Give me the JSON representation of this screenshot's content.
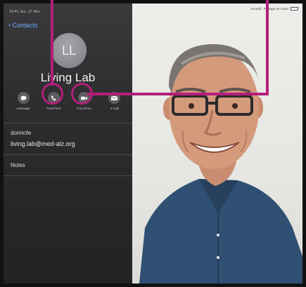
{
  "status_bar": {
    "left_text": "19:41 Jeu. 27 févr.",
    "right_text": "Accueil · Partage en cours"
  },
  "contact_nav": {
    "back_label": "Contacts"
  },
  "contact": {
    "initials": "LL",
    "name": "Living Lab",
    "actions": [
      {
        "label": "message",
        "icon": "message-icon"
      },
      {
        "label": "FaceTime",
        "icon": "phone-icon"
      },
      {
        "label": "FaceTime",
        "icon": "video-camera-icon"
      },
      {
        "label": "e-mail",
        "icon": "mail-icon"
      }
    ],
    "fields": [
      {
        "label": "domicile",
        "value": "living.lab@med-alz.org"
      }
    ],
    "notes_label": "Notes"
  },
  "colors": {
    "highlight": "#b41f7a",
    "link": "#6aa9ff",
    "panel": "#2c2c2e"
  }
}
